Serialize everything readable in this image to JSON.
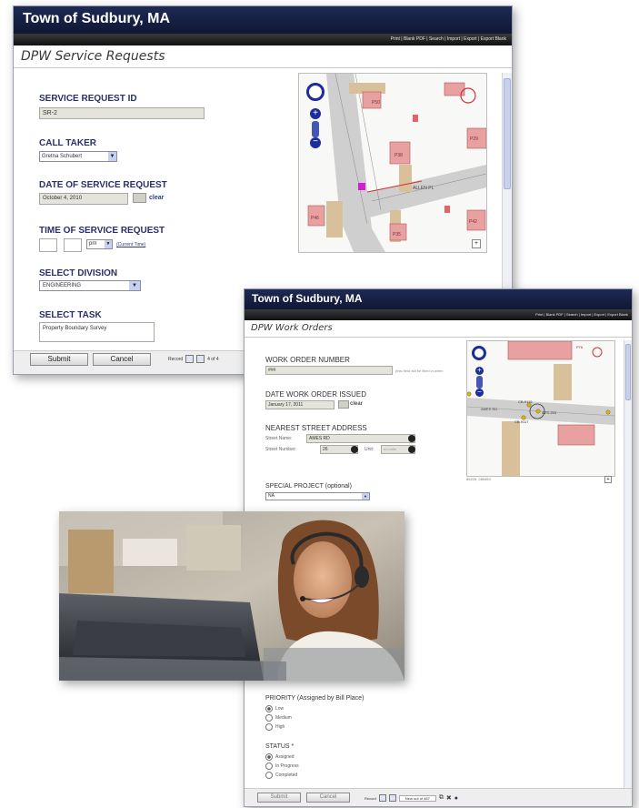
{
  "window1": {
    "title": "Town of Sudbury, MA",
    "toolbar_text": "Print  |  Blank PDF  |  Search  |  Import  |  Export  |  Export Blank",
    "page_title": "DPW Service Requests",
    "service_request_id_label": "SERVICE REQUEST ID",
    "service_request_id_value": "SR-2",
    "call_taker_label": "CALL TAKER",
    "call_taker_value": "Gretna Schubert",
    "date_label": "DATE OF SERVICE REQUEST",
    "date_value": "October 4, 2010",
    "clear_label": "clear",
    "time_label": "TIME OF SERVICE REQUEST",
    "time_ampm": "pm",
    "current_time_link": "(Current Time)",
    "division_label": "SELECT DIVISION",
    "division_value": "ENGINEERING",
    "task_label": "SELECT TASK",
    "task_value": "Property Boundary Survey",
    "submit_label": "Submit",
    "cancel_label": "Cancel",
    "record_label": "Record",
    "record_count": "4 of 4",
    "map_labels": {
      "street": "ALLEN PL",
      "p1": "P50",
      "p2": "P38",
      "p3": "P46",
      "p4": "P35",
      "p5": "P42",
      "p6": "P29"
    }
  },
  "window2": {
    "title": "Town of Sudbury, MA",
    "toolbar_text": "Print  |  Blank PDF  |  Search  |  Import  |  Export  |  Export Blank",
    "page_title": "DPW Work Orders",
    "work_order_label": "WORK ORDER NUMBER",
    "work_order_value": "###",
    "work_order_hint": "(this field will be filled in when",
    "date_issued_label": "DATE WORK ORDER ISSUED",
    "date_issued_value": "January 17, 2011",
    "clear_label": "clear",
    "address_label": "NEAREST STREET ADDRESS",
    "street_name_label": "Street Name:",
    "street_name_value": "AMES RD",
    "street_number_label": "Street Number:",
    "street_number_value": "26",
    "unit_label": "Unit:",
    "unit_value": "no units",
    "special_project_label": "SPECIAL PROJECT (optional)",
    "special_project_value": "NA",
    "priority_label": "PRIORITY (Assigned by Bill Place)",
    "priority_options": [
      "Low",
      "Medium",
      "High"
    ],
    "status_label": "STATUS *",
    "status_options": [
      "Assigned",
      "In Progress",
      "Completed"
    ],
    "submit_label": "Submit",
    "cancel_label": "Cancel",
    "record_label": "Record",
    "record_count": "New out of 487",
    "map_coords": "85226, 289453",
    "map_labels": {
      "street": "AMES RD",
      "cb1": "CB-9115",
      "cb2": "CB-9117",
      "cb3": "AES-253",
      "parcel": "P76"
    }
  }
}
